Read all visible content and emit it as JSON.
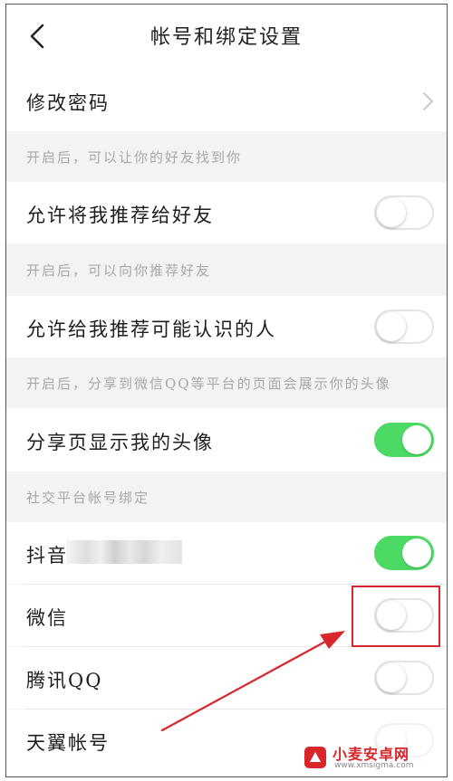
{
  "header": {
    "title": "帐号和绑定设置",
    "back_icon": "chevron-left-icon"
  },
  "rows": {
    "change_password": {
      "label": "修改密码",
      "icon": "chevron-right-icon"
    },
    "allow_recommend_me": {
      "label": "允许将我推荐给好友",
      "enabled": false
    },
    "allow_recommend_known": {
      "label": "允许给我推荐可能认识的人",
      "enabled": false
    },
    "show_avatar": {
      "label": "分享页显示我的头像",
      "enabled": true
    },
    "douyin": {
      "label": "抖音",
      "enabled": true
    },
    "wechat": {
      "label": "微信",
      "enabled": false
    },
    "qq": {
      "label": "腾讯QQ",
      "enabled": false
    },
    "tianyi": {
      "label": "天翼帐号",
      "enabled": false
    }
  },
  "sections": {
    "find_friends_hint": "开启后，可以让你的好友找到你",
    "recommend_friends_hint": "开启后，可以向你推荐好友",
    "avatar_hint": "开启后，分享到微信QQ等平台的页面会展示你的头像",
    "social_binding_title": "社交平台帐号绑定"
  },
  "colors": {
    "toggle_on": "#4cd964",
    "highlight": "#d9262a",
    "arrow": "#d9262a"
  },
  "watermark": {
    "title": "小麦安卓网",
    "url": "www.xmsigma.com"
  }
}
